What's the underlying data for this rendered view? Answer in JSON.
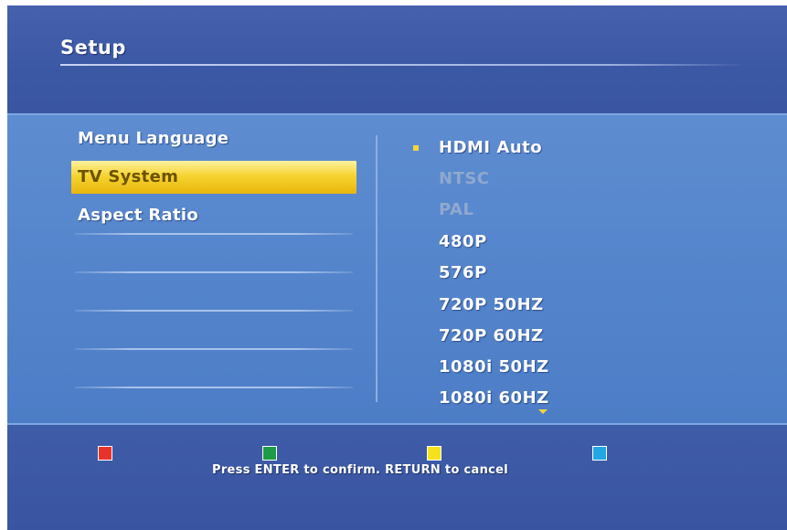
{
  "header": {
    "title": "Setup"
  },
  "menu": {
    "items": [
      {
        "label": "Menu Language",
        "selected": false
      },
      {
        "label": "TV System",
        "selected": true
      },
      {
        "label": "Aspect Ratio",
        "selected": false
      }
    ]
  },
  "options": {
    "current": "HDMI Auto",
    "items": [
      {
        "label": "HDMI Auto",
        "enabled": true
      },
      {
        "label": "NTSC",
        "enabled": false
      },
      {
        "label": "PAL",
        "enabled": false
      },
      {
        "label": "480P",
        "enabled": true
      },
      {
        "label": "576P",
        "enabled": true
      },
      {
        "label": "720P 50HZ",
        "enabled": true
      },
      {
        "label": "720P 60HZ",
        "enabled": true
      },
      {
        "label": "1080i 50HZ",
        "enabled": true
      },
      {
        "label": "1080i 60HZ",
        "enabled": true
      }
    ],
    "more_below_icon": "arrow-down-icon"
  },
  "footer": {
    "keys": [
      {
        "name": "red-key-icon",
        "color": "#e8332c"
      },
      {
        "name": "green-key-icon",
        "color": "#1f9a47"
      },
      {
        "name": "yellow-key-icon",
        "color": "#f6e21a"
      },
      {
        "name": "blue-key-icon",
        "color": "#23a6e4"
      }
    ],
    "hint": "Press ENTER to confirm. RETURN to cancel"
  },
  "colors": {
    "background": "#3e5aa6",
    "panel": "#5485cc",
    "highlight": "#f6d431",
    "bullet": "#f5d53a"
  }
}
